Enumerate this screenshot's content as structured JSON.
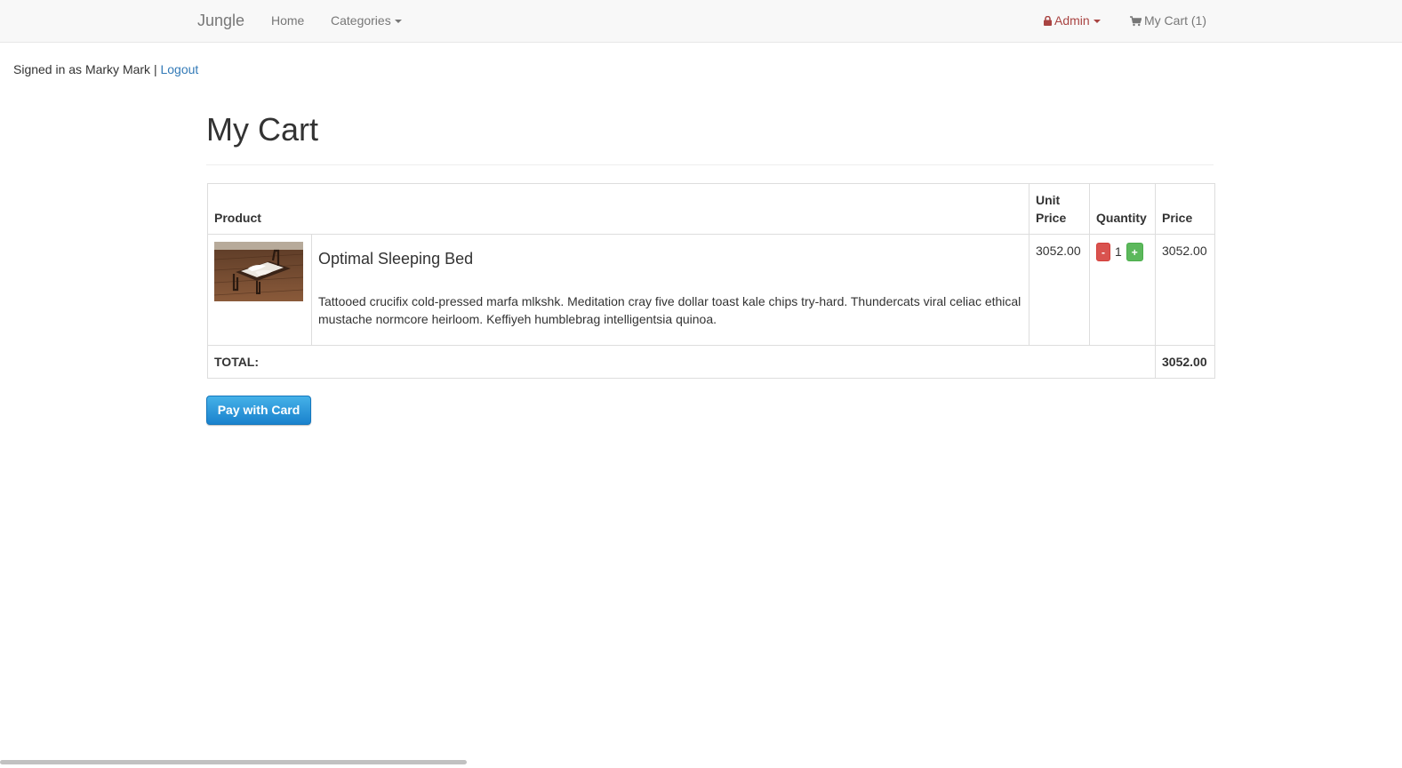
{
  "navbar": {
    "brand": "Jungle",
    "home": "Home",
    "categories": "Categories",
    "admin": "Admin",
    "cart": "My Cart (1)",
    "admin_color": "#a94442"
  },
  "session": {
    "signed_in_text": "Signed in as Marky Mark |",
    "logout": "Logout"
  },
  "page": {
    "title": "My Cart"
  },
  "table": {
    "headers": {
      "product": "Product",
      "unit_price": "Unit Price",
      "quantity": "Quantity",
      "price": "Price"
    },
    "items": [
      {
        "name": "Optimal Sleeping Bed",
        "description": "Tattooed crucifix cold-pressed marfa mlkshk. Meditation cray five dollar toast kale chips try-hard. Thundercats viral celiac ethical mustache normcore heirloom. Keffiyeh humblebrag intelligentsia quinoa.",
        "unit_price": "3052.00",
        "quantity": "1",
        "price": "3052.00",
        "decrease_label": "-",
        "increase_label": "+",
        "image_icon": "bed-product-photo"
      }
    ],
    "total_label": "TOTAL:",
    "total_value": "3052.00"
  },
  "checkout": {
    "pay_label": "Pay with Card",
    "accent": "#1a82cd"
  },
  "icons": {
    "lock": "lock-icon",
    "cart": "shopping-cart-icon",
    "caret": "caret-down-icon"
  }
}
